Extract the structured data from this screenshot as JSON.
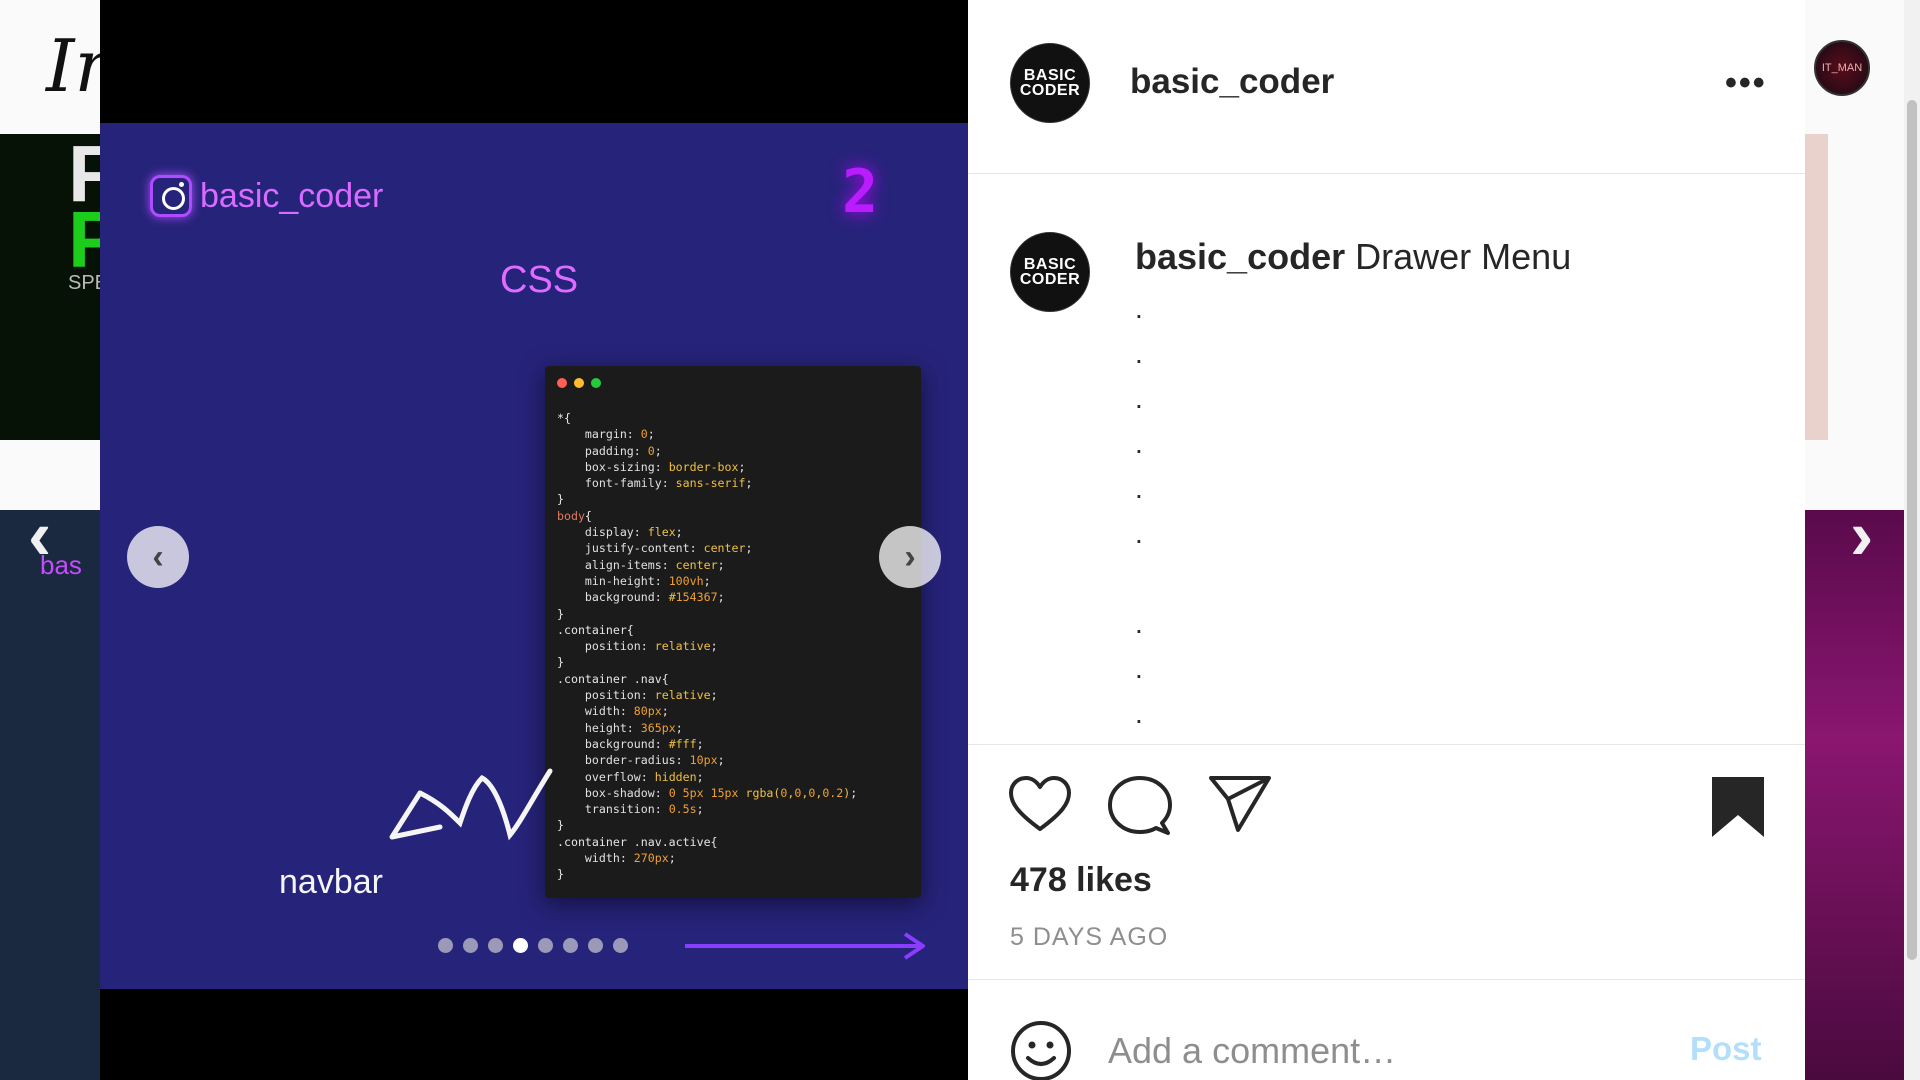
{
  "background": {
    "logo_text": "In",
    "tile1_big_top": "F",
    "tile1_big_bottom": "P",
    "tile1_small": "SPE",
    "tile2_tag": "bas",
    "profile_avatar_text": "IT_MAN"
  },
  "slide": {
    "ig_handle": "basic_coder",
    "number": "2",
    "language": "CSS",
    "caption_word": "navbar",
    "dots_total": 8,
    "active_index": 3,
    "code_lines": [
      "*{",
      "    margin: 0;",
      "    padding: 0;",
      "    box-sizing: border-box;",
      "    font-family: sans-serif;",
      "}",
      "body{",
      "    display: flex;",
      "    justify-content: center;",
      "    align-items: center;",
      "    min-height: 100vh;",
      "    background: #154367;",
      "}",
      ".container{",
      "    position: relative;",
      "}",
      ".container .nav{",
      "    position: relative;",
      "    width: 80px;",
      "    height: 365px;",
      "    background: #fff;",
      "    border-radius: 10px;",
      "    overflow: hidden;",
      "    box-shadow: 0 5px 15px rgba(0,0,0,0.2);",
      "    transition: 0.5s;",
      "}",
      ".container .nav.active{",
      "    width: 270px;",
      "}"
    ]
  },
  "post": {
    "handle": "basic_coder",
    "avatar_text_top": "BASIC",
    "avatar_text_bottom": "CODER",
    "more_label": "•••",
    "caption_title": "Drawer Menu",
    "caption_dot": ".",
    "likes": "478 likes",
    "time_ago": "5 DAYS AGO"
  },
  "comment": {
    "placeholder": "Add a comment…",
    "post_label": "Post"
  },
  "colors": {
    "slide_bg": "#26237a",
    "accent_purple": "#b04cff",
    "post_disabled_blue": "#b2dffc"
  }
}
